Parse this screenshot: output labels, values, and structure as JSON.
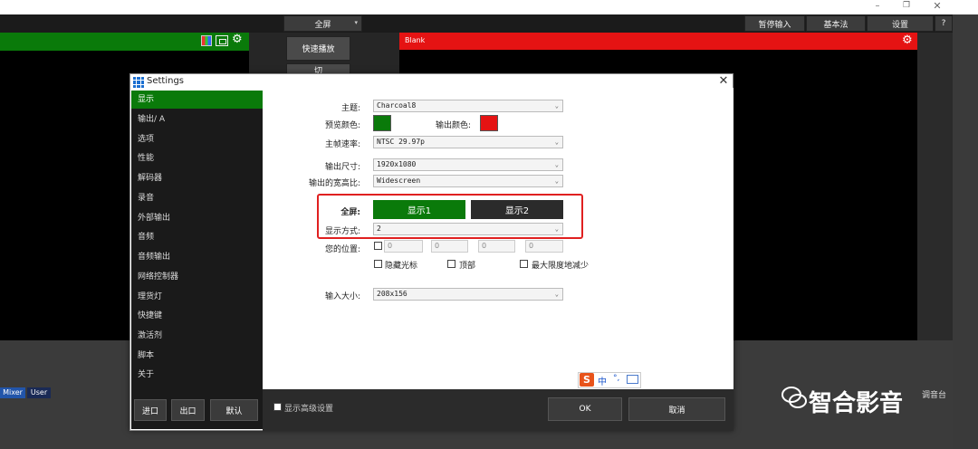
{
  "window": {
    "minimize_glyph": "–",
    "restore_glyph": "❐",
    "close_glyph": "✕"
  },
  "topbar": {
    "fullscreen_dropdown": "全屏",
    "pause_input": "暂停输入",
    "basic_method": "基本法",
    "settings": "设置",
    "help": "?"
  },
  "preview": {
    "header_color": "#0a7a0a"
  },
  "program": {
    "label": "Blank",
    "header_color": "#e51313"
  },
  "middle": {
    "quick_play": "快速播放",
    "cut": "切"
  },
  "bottom": {
    "mixer_tab": "Mixer",
    "user_tab": "User",
    "audio_label": "调音台"
  },
  "dialog": {
    "title": "Settings",
    "close": "✕",
    "sidebar": [
      "显示",
      "输出/ A",
      "选项",
      "性能",
      "解码器",
      "录音",
      "外部输出",
      "音频",
      "音频输出",
      "网络控制器",
      "理货灯",
      "快捷键",
      "激活剂",
      "脚本",
      "关于"
    ],
    "active_index": 0,
    "import": "进口",
    "export": "出口",
    "default": "默认",
    "show_advanced": "显示高级设置",
    "ok": "OK",
    "cancel": "取消",
    "fields": {
      "theme_label": "主题:",
      "theme_value": "Charcoal8",
      "preview_color_label": "预览颜色:",
      "preview_color": "#0a7a0a",
      "output_color_label": "输出颜色:",
      "output_color": "#e51313",
      "frame_rate_label": "主帧速率:",
      "frame_rate_value": "NTSC 29.97p",
      "output_size_label": "输出尺寸:",
      "output_size_value": "1920x1080",
      "aspect_label": "输出的宽高比:",
      "aspect_value": "Widescreen",
      "fullscreen_label": "全屏:",
      "display1": "显示1",
      "display2": "显示2",
      "display_mode_label": "显示方式:",
      "display_mode_value": "2",
      "position_label": "您的位置:",
      "pos_values": [
        "0",
        "0",
        "0",
        "0"
      ],
      "hide_cursor": "隐藏光标",
      "top": "顶部",
      "min_reduce": "最大限度地减少",
      "input_size_label": "输入大小:",
      "input_size_value": "208x156"
    }
  },
  "ime": {
    "logo": "S",
    "lang": "中",
    "punct": "°,"
  },
  "watermark": {
    "text": "智合影音"
  }
}
